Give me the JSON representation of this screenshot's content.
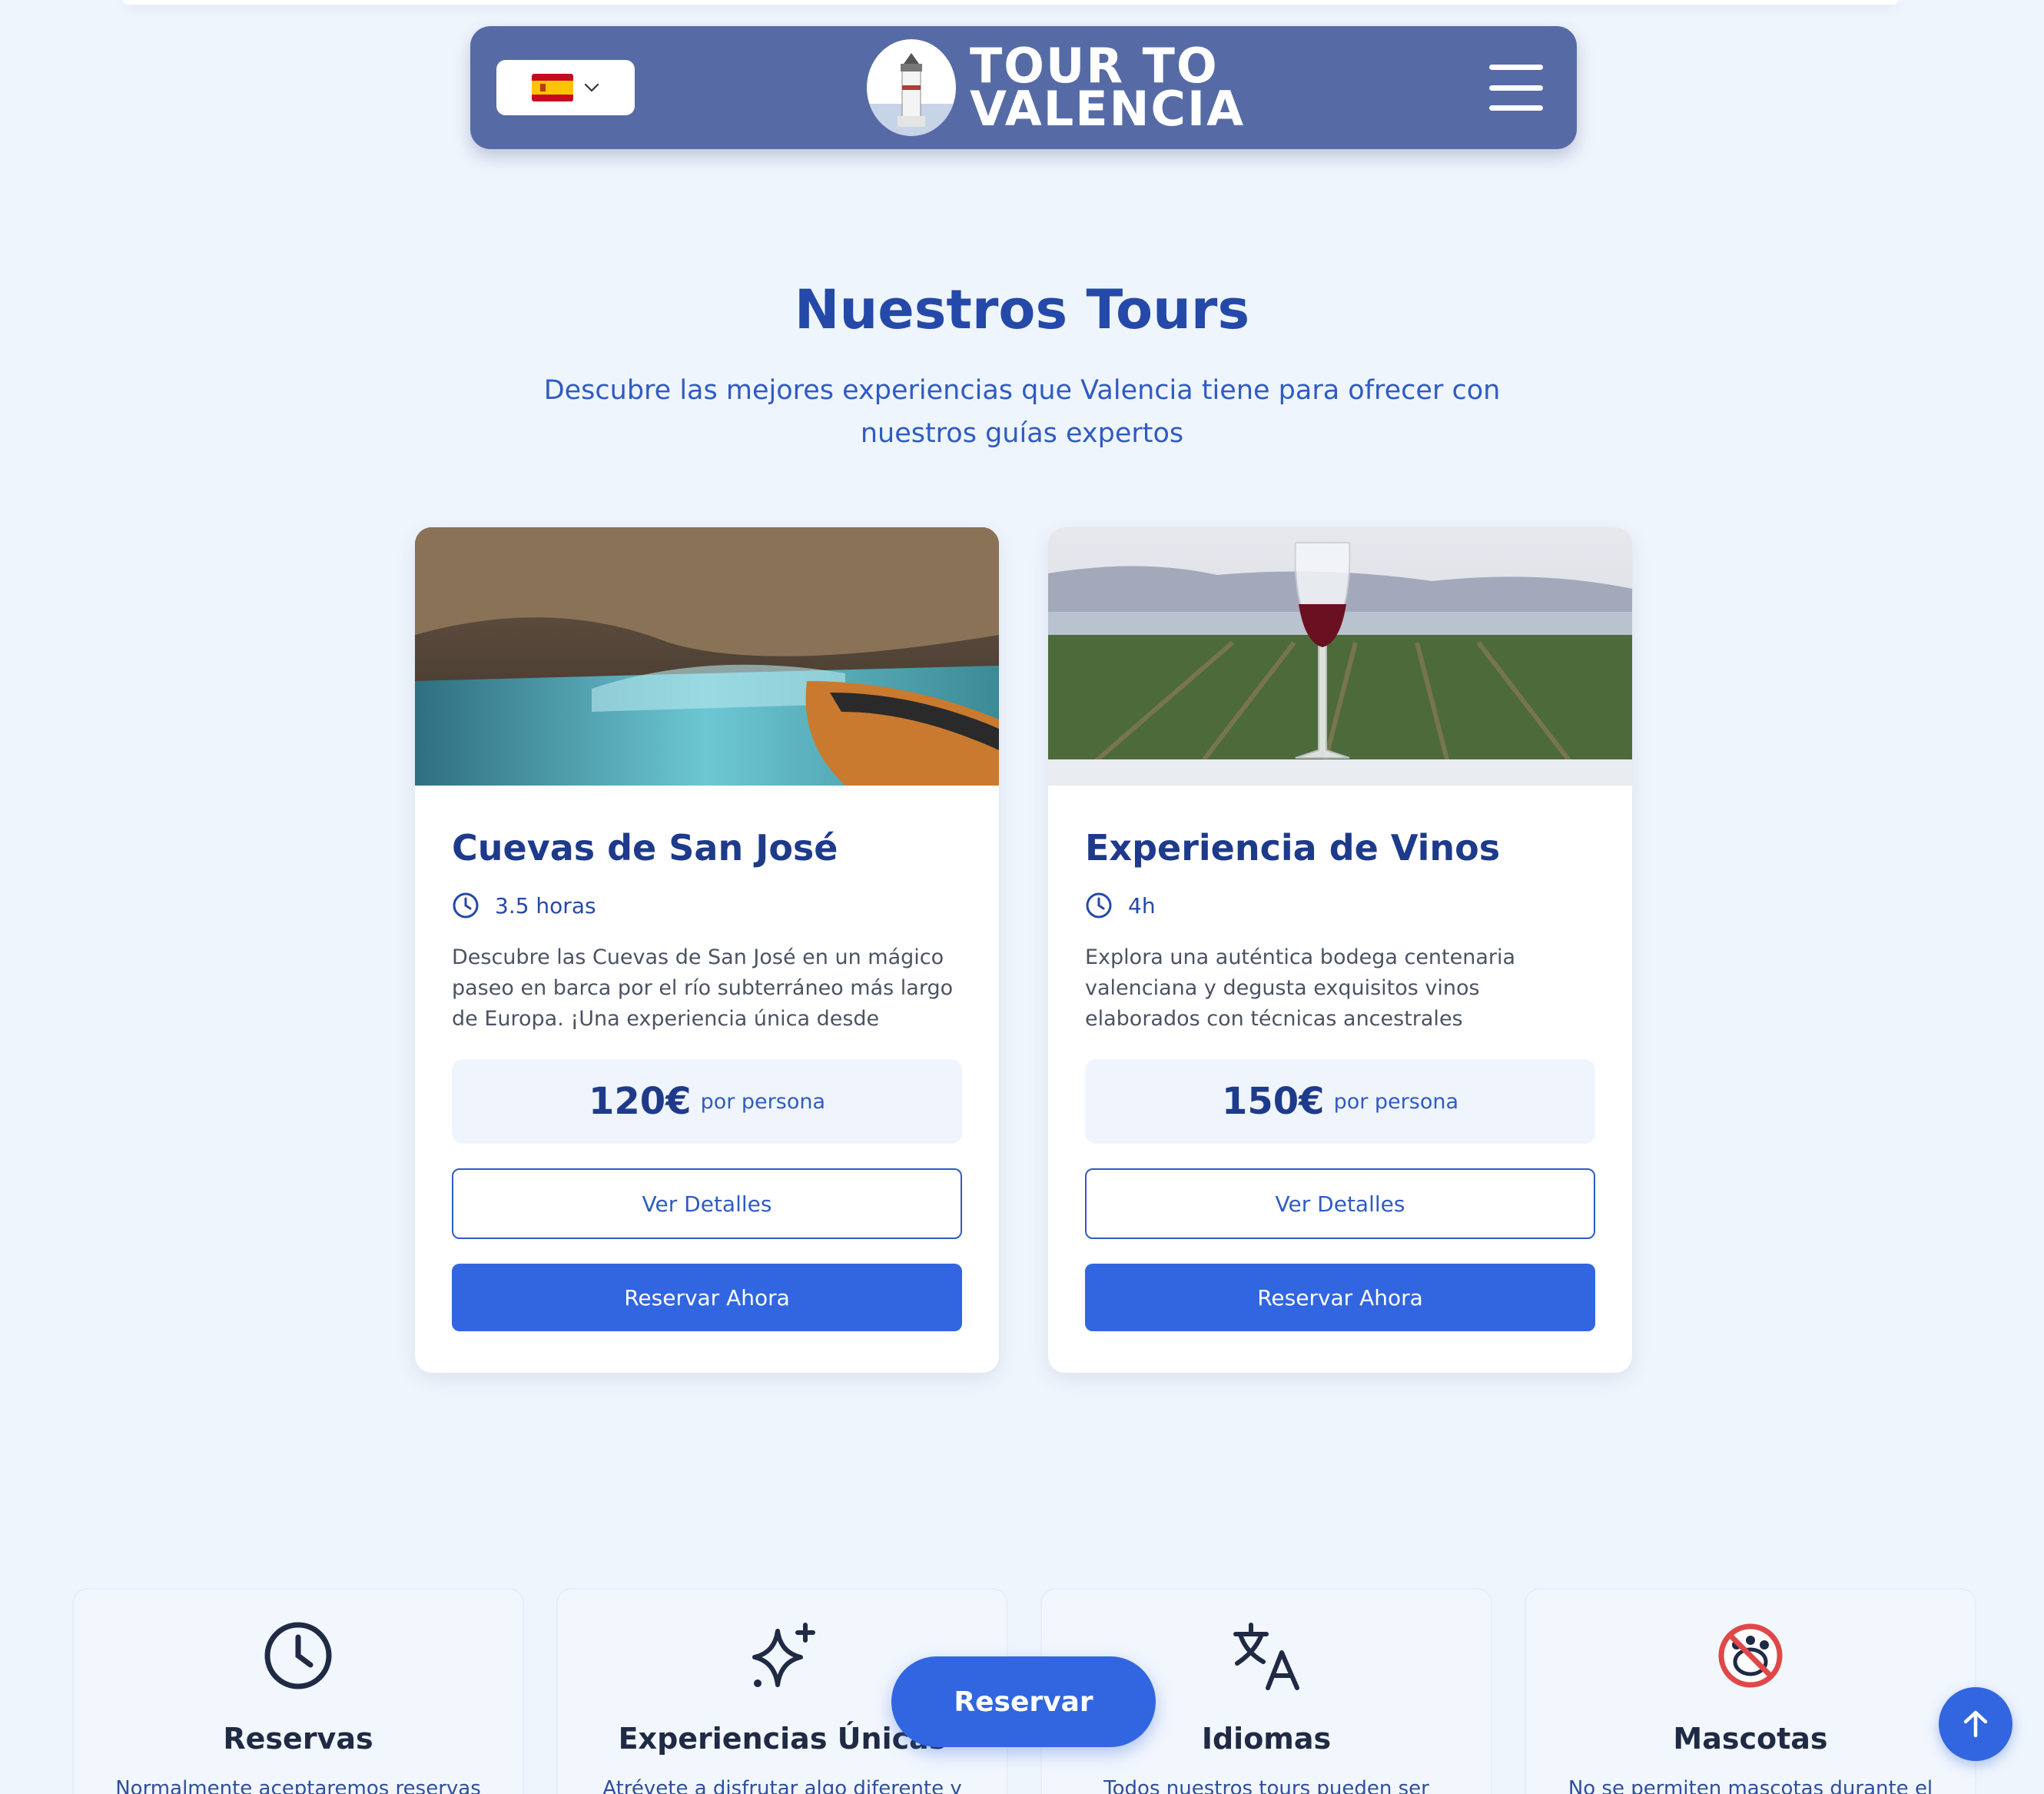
{
  "header": {
    "language": {
      "flag": "spain-flag-icon",
      "selected": "es"
    },
    "logo_line1": "TOUR TO",
    "logo_line2": "VALENCIA",
    "menu_icon": "hamburger-menu-icon",
    "bar_color": "#566ba6"
  },
  "section": {
    "title": "Nuestros Tours",
    "subtitle": "Descubre las mejores experiencias que Valencia tiene para ofrecer con nuestros guías expertos"
  },
  "tours": [
    {
      "title": "Cuevas de San José",
      "duration": "3.5 horas",
      "description": "Descubre las Cuevas de San José en un mágico paseo en barca por el río subterráneo más largo de Europa. ¡Una experiencia única desde Valencia!",
      "price": "120€",
      "price_unit": "por persona",
      "details_label": "Ver Detalles",
      "book_label": "Reservar Ahora"
    },
    {
      "title": "Experiencia de Vinos",
      "duration": "4h",
      "description": "Explora una auténtica bodega centenaria valenciana y degusta exquisitos vinos elaborados con técnicas ancestrales transmitidas por...",
      "price": "150€",
      "price_unit": "por persona",
      "details_label": "Ver Detalles",
      "book_label": "Reservar Ahora"
    }
  ],
  "features": [
    {
      "icon": "clock-icon",
      "title": "Reservas",
      "text": "Normalmente aceptaremos reservas"
    },
    {
      "icon": "sparkles-icon",
      "title": "Experiencias Únicas",
      "text": "Atrévete a disfrutar algo diferente y"
    },
    {
      "icon": "translate-icon",
      "title": "Idiomas",
      "text": "Todos nuestros tours pueden ser"
    },
    {
      "icon": "no-pets-icon",
      "title": "Mascotas",
      "text": "No se permiten mascotas durante el"
    }
  ],
  "floating": {
    "reserve_label": "Reservar",
    "scroll_top_icon": "arrow-up-icon"
  },
  "colors": {
    "accent": "#3166e0",
    "heading": "#1e3a8a",
    "background": "#eff5fd"
  }
}
